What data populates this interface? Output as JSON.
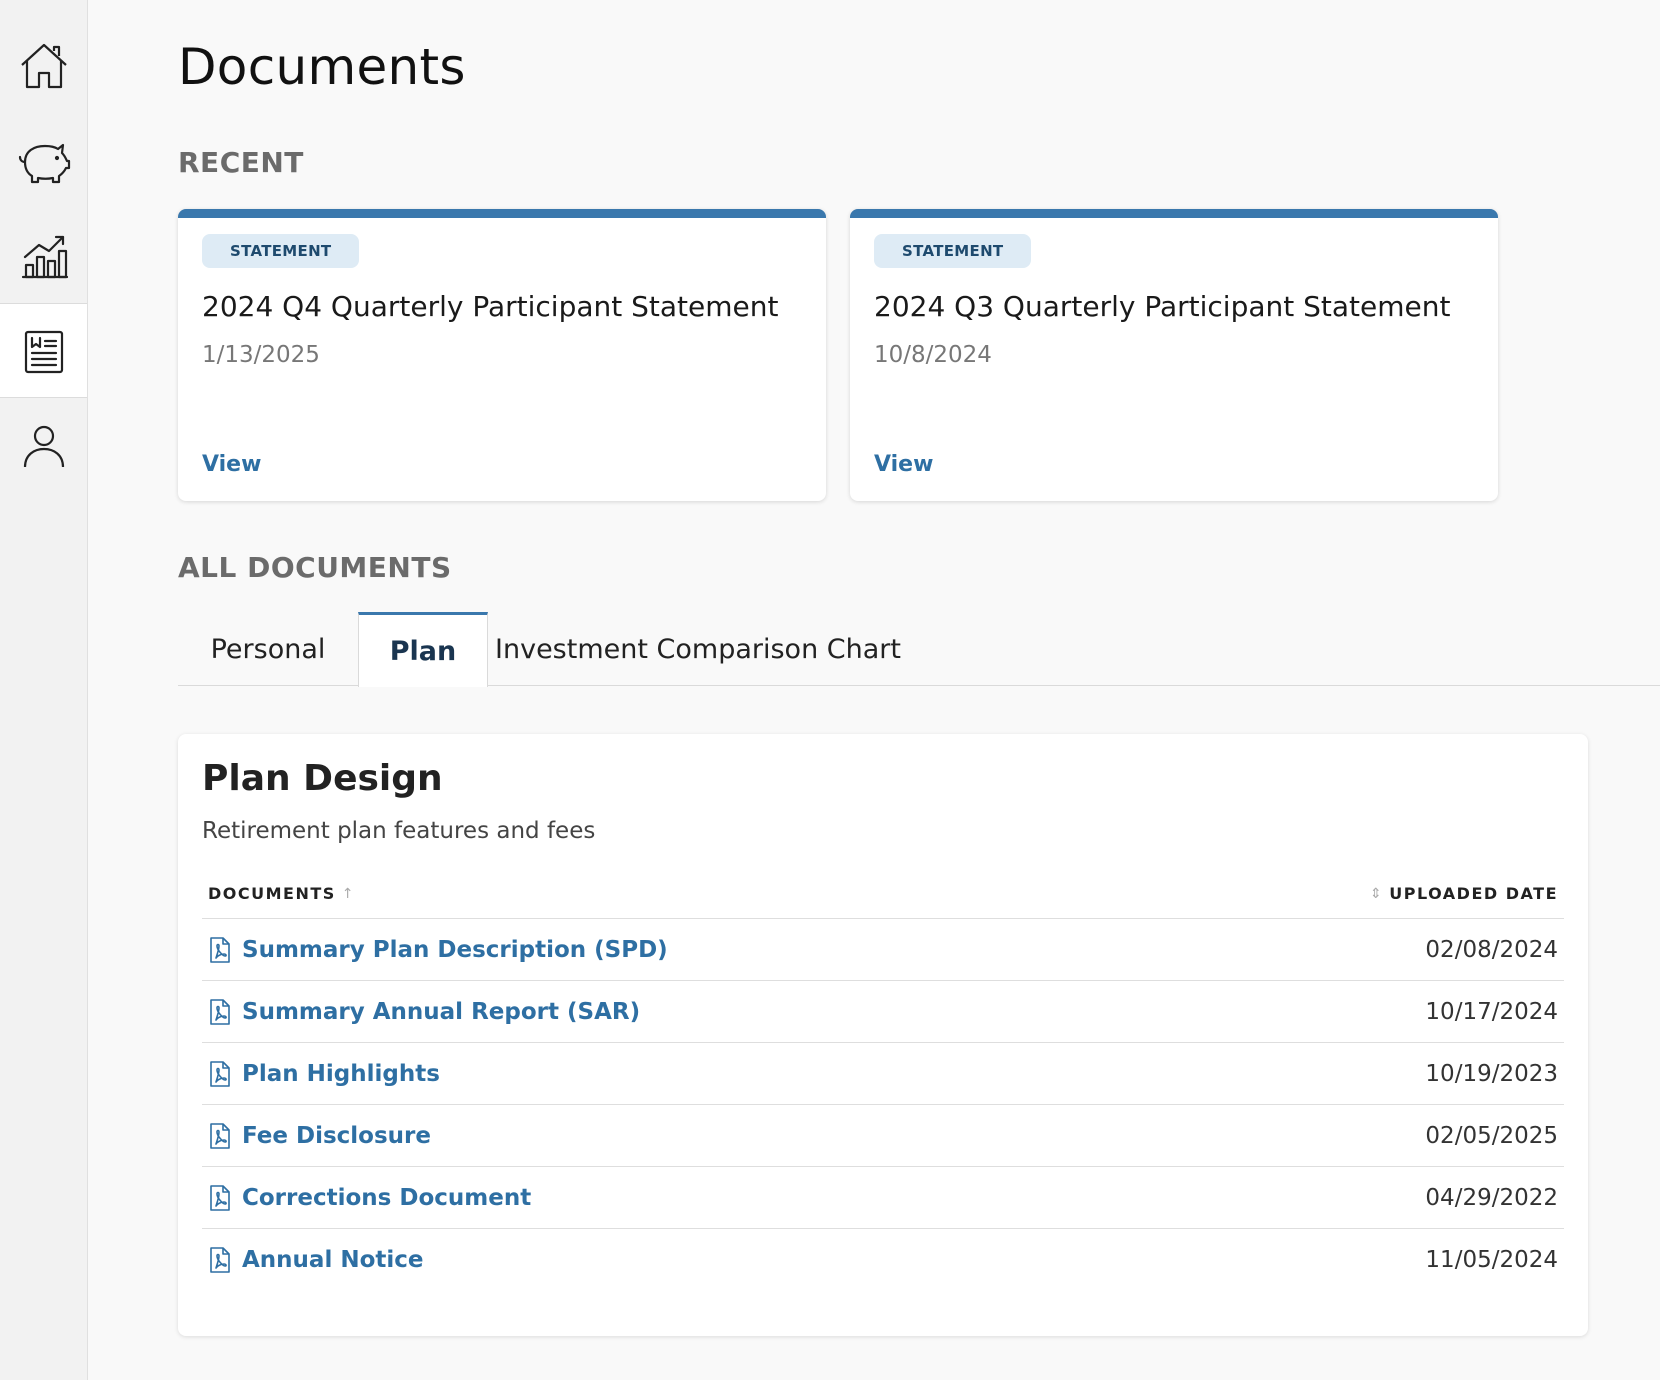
{
  "page_title": "Documents",
  "sections": {
    "recent": "RECENT",
    "all": "ALL DOCUMENTS"
  },
  "recent_cards": [
    {
      "badge": "STATEMENT",
      "title": "2024 Q4 Quarterly Participant Statement",
      "date": "1/13/2025",
      "link": "View"
    },
    {
      "badge": "STATEMENT",
      "title": "2024 Q3 Quarterly Participant Statement",
      "date": "10/8/2024",
      "link": "View"
    }
  ],
  "tabs": [
    {
      "label": "Personal",
      "active": false
    },
    {
      "label": "Plan",
      "active": true
    },
    {
      "label": "Investment Comparison Chart",
      "active": false
    }
  ],
  "plan_design": {
    "title": "Plan Design",
    "subtitle": "Retirement plan features and fees",
    "columns": {
      "documents": "DOCUMENTS",
      "uploaded": "UPLOADED DATE"
    },
    "rows": [
      {
        "name": "Summary Plan Description (SPD)",
        "date": "02/08/2024"
      },
      {
        "name": "Summary Annual Report (SAR)",
        "date": "10/17/2024"
      },
      {
        "name": "Plan Highlights",
        "date": "10/19/2023"
      },
      {
        "name": "Fee Disclosure",
        "date": "02/05/2025"
      },
      {
        "name": "Corrections Document",
        "date": "04/29/2022"
      },
      {
        "name": "Annual Notice",
        "date": "11/05/2024"
      }
    ]
  },
  "sidebar_icons": [
    "home-icon",
    "piggy-bank-icon",
    "chart-growth-icon",
    "documents-icon",
    "profile-icon"
  ],
  "colors": {
    "accent": "#3a78ad",
    "link": "#2e6fa3",
    "badge_bg": "#deebf5"
  }
}
